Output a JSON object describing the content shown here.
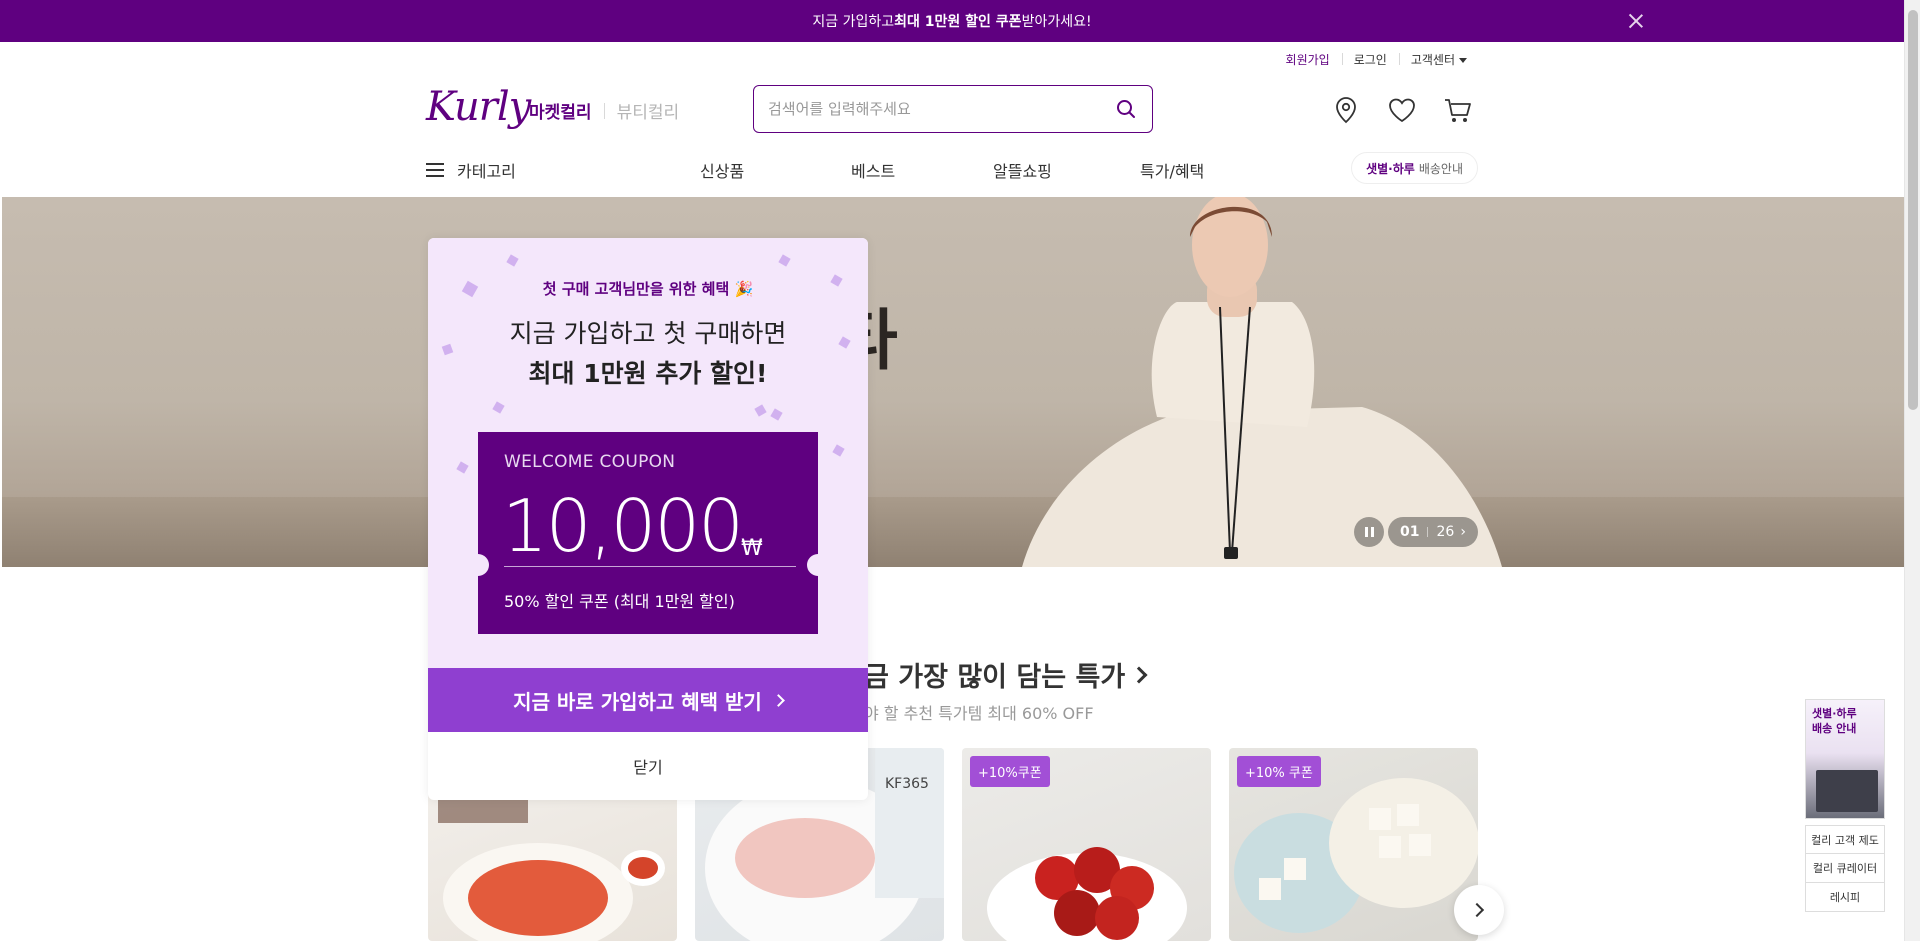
{
  "promo_bar": {
    "text_before": "지금 가입하고 ",
    "text_bold": "최대 1만원 할인 쿠폰",
    "text_after": " 받아가세요!",
    "close_icon": "close-icon"
  },
  "util_links": {
    "signup": "회원가입",
    "login": "로그인",
    "customer_center": "고객센터"
  },
  "header": {
    "logo": "Kurly",
    "store_active": "마켓컬리",
    "store_inactive": "뷰티컬리",
    "search_placeholder": "검색어를 입력해주세요",
    "icons": [
      "location-pin-icon",
      "heart-icon",
      "cart-icon"
    ]
  },
  "nav": {
    "category": "카테고리",
    "items": [
      "신상품",
      "베스트",
      "알뜰쇼핑",
      "특가/혜택"
    ],
    "delivery_bold": "샛별·하루",
    "delivery_rest": "배송안내"
  },
  "hero": {
    "text": "타",
    "page_current": "01",
    "page_total": "26"
  },
  "section": {
    "title": "금 가장 많이 담는 특가",
    "subtitle": "야 할 추천 특가템 최대 60% OFF"
  },
  "products": [
    {
      "badge": ""
    },
    {
      "badge": ""
    },
    {
      "badge": "+10%쿠폰"
    },
    {
      "badge": "+10% 쿠폰"
    }
  ],
  "side_widget": {
    "banner_line1": "샛별·하루",
    "banner_line2": "배송 안내",
    "links": [
      "컬리 고객 제도",
      "컬리 큐레이터",
      "레시피"
    ]
  },
  "popup": {
    "subtitle": "첫 구매 고객님만을 위한 혜택 🎉",
    "headline1": "지금 가입하고 첫 구매하면",
    "headline2": "최대 1만원 추가 할인!",
    "coupon_label": "WELCOME COUPON",
    "coupon_amount": "10,000",
    "coupon_currency": "₩",
    "coupon_desc": "50% 할인 쿠폰 (최대 1만원 할인)",
    "cta": "지금 바로 가입하고 혜택 받기",
    "close": "닫기"
  },
  "colors": {
    "brand": "#5f0080",
    "cta": "#8f3fd0",
    "popup_bg": "#f4e7fb"
  }
}
